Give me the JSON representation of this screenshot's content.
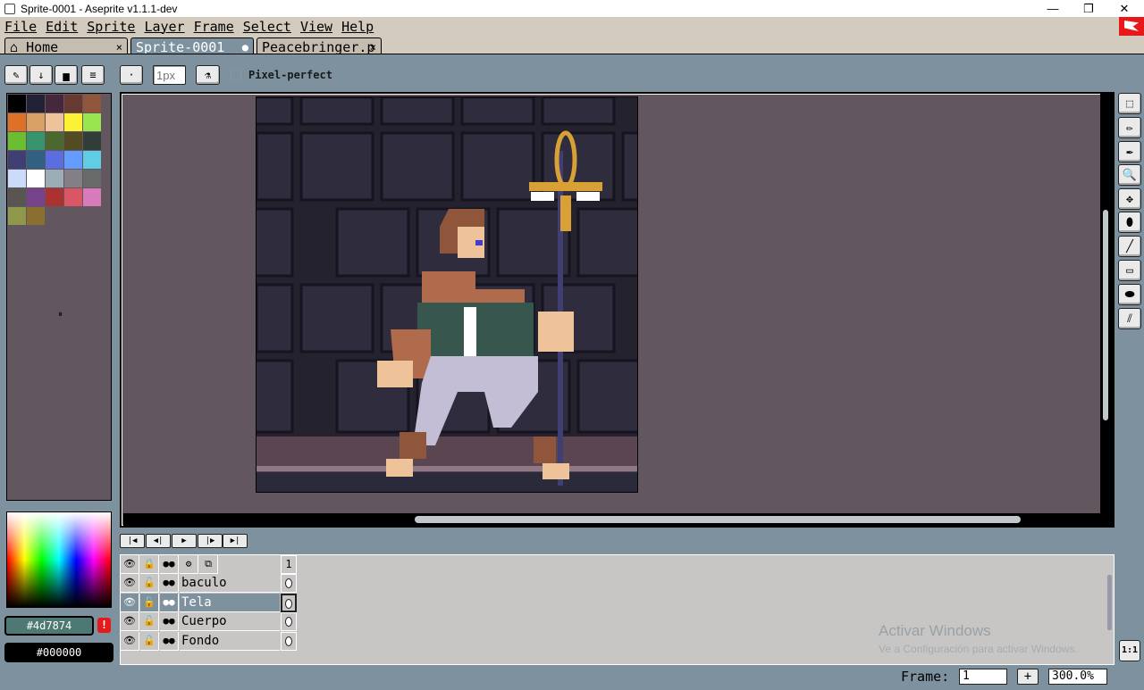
{
  "window": {
    "title": "Sprite-0001 - Aseprite v1.1.1-dev",
    "minimize": "—",
    "restore": "❐",
    "close": "✕"
  },
  "menu": [
    "File",
    "Edit",
    "Sprite",
    "Layer",
    "Frame",
    "Select",
    "View",
    "Help"
  ],
  "tabs": [
    {
      "icon": "⌂",
      "label": "Home",
      "close": "×"
    },
    {
      "label": "Sprite-0001",
      "close": "●"
    },
    {
      "label": "Peacebringer.p",
      "close": "×"
    }
  ],
  "context_bar": {
    "brush_size_placeholder": "1px",
    "pixel_perfect_label": "Pixel-perfect",
    "pixel_perfect_checked": false
  },
  "palette": {
    "colors": [
      "#000000",
      "#222034",
      "#45283c",
      "#663931",
      "#8f563b",
      "#df7126",
      "#d9a066",
      "#eec39a",
      "#fbf236",
      "#99e550",
      "#6abe30",
      "#37946e",
      "#4b692f",
      "#524b24",
      "#323c39",
      "#3f3f74",
      "#306082",
      "#5b6ee1",
      "#639bff",
      "#5fcde4",
      "#cbdbfc",
      "#ffffff",
      "#9badb7",
      "#847e87",
      "#696a6a",
      "#595652",
      "#76428a",
      "#ac3232",
      "#d95763",
      "#d77bba",
      "#8f974a",
      "#8a6f30"
    ],
    "resize_handle": "⏸"
  },
  "colors": {
    "foreground": "#4d7874",
    "background": "#000000",
    "warning_icon": "!"
  },
  "tools": [
    {
      "name": "marquee-tool-icon",
      "glyph": "⬚"
    },
    {
      "name": "pencil-tool-icon",
      "glyph": "✏"
    },
    {
      "name": "eyedropper-tool-icon",
      "glyph": "✒"
    },
    {
      "name": "zoom-tool-icon",
      "glyph": "🔍"
    },
    {
      "name": "move-tool-icon",
      "glyph": "✥"
    },
    {
      "name": "fill-tool-icon",
      "glyph": "⬮"
    },
    {
      "name": "line-tool-icon",
      "glyph": "╱"
    },
    {
      "name": "rectangle-tool-icon",
      "glyph": "▭"
    },
    {
      "name": "contour-tool-icon",
      "glyph": "⬬"
    },
    {
      "name": "blur-tool-icon",
      "glyph": "⫽"
    }
  ],
  "context_icons": {
    "pencil": "✎",
    "arrow": "↓",
    "fill": "▅",
    "menu": "≡",
    "brush_type": "·",
    "ink": "⚗"
  },
  "playback": [
    "|◀",
    "◀|",
    "▶",
    "|▶",
    "▶|"
  ],
  "timeline": {
    "header_icons": [
      "👁",
      "🔒",
      "●●",
      "⚙",
      "⧉"
    ],
    "frame_number": "1",
    "layers": [
      {
        "name": "baculo",
        "active": false
      },
      {
        "name": "Tela",
        "active": true
      },
      {
        "name": "Cuerpo",
        "active": false
      },
      {
        "name": "Fondo",
        "active": false
      }
    ],
    "eye": "👁",
    "lock": "🔓",
    "continuous": "●●"
  },
  "watermark": {
    "title": "Activar Windows",
    "subtitle": "Ve a Configuración para activar Windows."
  },
  "status": {
    "frame_label": "Frame:",
    "frame_value": "1",
    "plus": "+",
    "zoom_value": "300.0%",
    "zoom_one": "1:1"
  },
  "accent_colors": {
    "panel": "#7d929e",
    "menubar": "#d3cbbe",
    "canvas_bg": "#62575e",
    "timeline_bg": "#c8c6c5"
  }
}
